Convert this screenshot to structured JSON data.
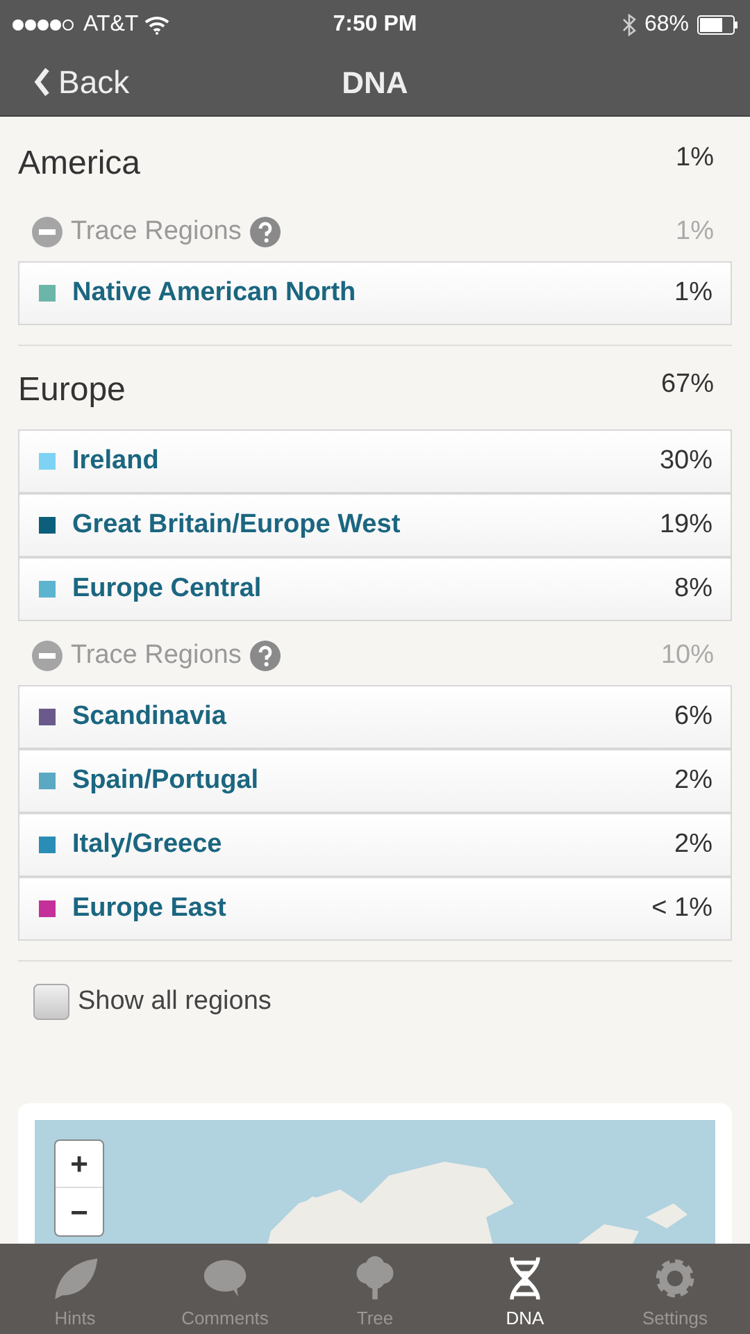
{
  "status_bar": {
    "carrier": "AT&T",
    "time": "7:50 PM",
    "battery": "68%"
  },
  "nav": {
    "back": "Back",
    "title": "DNA"
  },
  "sections": [
    {
      "name": "America",
      "percent": "1%",
      "items": [
        {
          "kind": "trace",
          "label": "Trace Regions",
          "percent": "1%"
        },
        {
          "kind": "region",
          "label": "Native American North",
          "percent": "1%",
          "color": "#6bb5a9"
        }
      ]
    },
    {
      "name": "Europe",
      "percent": "67%",
      "items": [
        {
          "kind": "region",
          "label": "Ireland",
          "percent": "30%",
          "color": "#7ed3f4"
        },
        {
          "kind": "region",
          "label": "Great Britain/Europe West",
          "percent": "19%",
          "color": "#0d5e7a"
        },
        {
          "kind": "region",
          "label": "Europe Central",
          "percent": "8%",
          "color": "#5db4cf"
        },
        {
          "kind": "trace",
          "label": "Trace Regions",
          "percent": "10%"
        },
        {
          "kind": "region",
          "label": "Scandinavia",
          "percent": "6%",
          "color": "#6a5a8c"
        },
        {
          "kind": "region",
          "label": "Spain/Portugal",
          "percent": "2%",
          "color": "#5aa8c2"
        },
        {
          "kind": "region",
          "label": "Italy/Greece",
          "percent": "2%",
          "color": "#2a8db5"
        },
        {
          "kind": "region",
          "label": "Europe East",
          "percent": "< 1%",
          "color": "#c4309a"
        }
      ]
    }
  ],
  "show_all": {
    "label": "Show all regions",
    "checked": false
  },
  "map": {
    "zoom_in": "+",
    "zoom_out": "−"
  },
  "tabs": [
    {
      "label": "Hints",
      "kind": "leaf",
      "selected": false
    },
    {
      "label": "Comments",
      "kind": "bubble",
      "selected": false
    },
    {
      "label": "Tree",
      "kind": "tree",
      "selected": false
    },
    {
      "label": "DNA",
      "kind": "dna",
      "selected": true
    },
    {
      "label": "Settings",
      "kind": "gear",
      "selected": false
    }
  ]
}
